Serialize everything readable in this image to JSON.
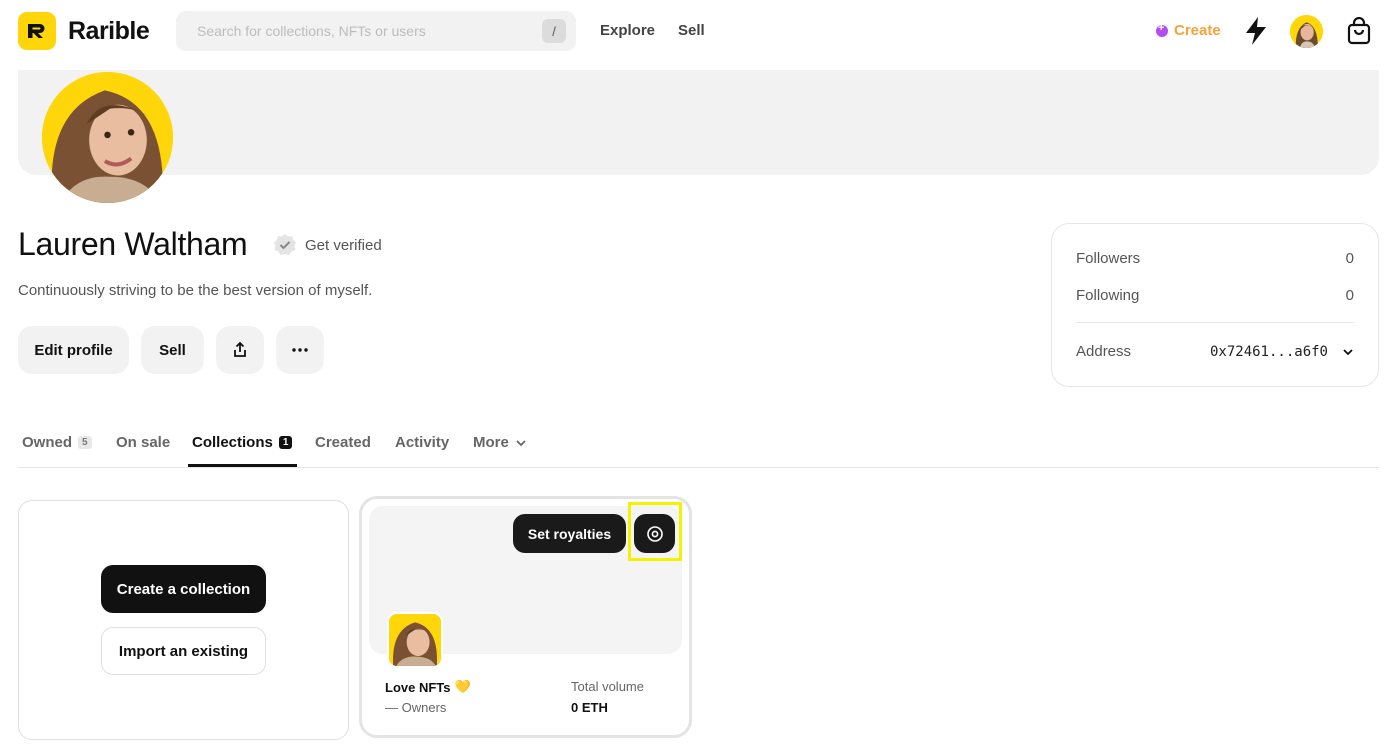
{
  "header": {
    "brand": "Rarible",
    "search_placeholder": "Search for collections, NFTs or users",
    "search_shortcut": "/",
    "nav": {
      "explore": "Explore",
      "sell": "Sell"
    },
    "create_label": "Create",
    "icons": {
      "activity": "bolt-icon",
      "cart": "shopping-bag-icon"
    }
  },
  "profile": {
    "name": "Lauren Waltham",
    "get_verified": "Get verified",
    "bio": "Continuously striving to be the best version of myself.",
    "buttons": {
      "edit": "Edit profile",
      "sell": "Sell"
    }
  },
  "stats": {
    "followers_label": "Followers",
    "followers_value": "0",
    "following_label": "Following",
    "following_value": "0",
    "address_label": "Address",
    "address_value": "0x72461...a6f0"
  },
  "tabs": {
    "owned": "Owned",
    "owned_count": "5",
    "on_sale": "On sale",
    "collections": "Collections",
    "collections_count": "1",
    "created": "Created",
    "activity": "Activity",
    "more": "More",
    "active": "Collections"
  },
  "create_card": {
    "create_label": "Create a collection",
    "import_label": "Import an existing"
  },
  "collection": {
    "set_royalties": "Set royalties",
    "name": "Love NFTs",
    "name_emoji": "💛",
    "owners": "— Owners",
    "volume_label": "Total volume",
    "volume_value": "0 ETH"
  },
  "colors": {
    "brand_yellow": "#FFD60A",
    "create_orange": "#F6A33A",
    "create_purple": "#B44DF0",
    "highlight": "#F5F200"
  }
}
